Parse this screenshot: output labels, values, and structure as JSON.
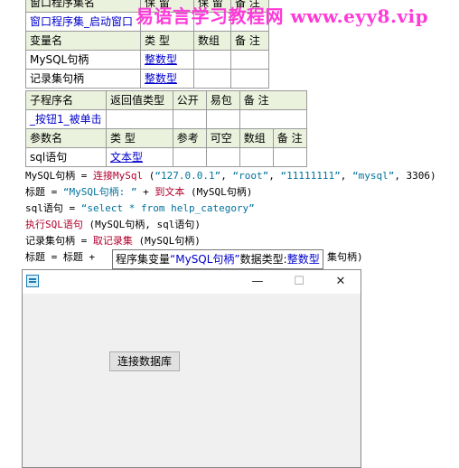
{
  "watermark": "易语言学习教程网 www.eyy8.vip",
  "table1": {
    "row0": [
      "窗口程序集名",
      "保 留",
      "保 留",
      "备 注"
    ],
    "row1": "窗口程序集_启动窗口",
    "header": [
      "变量名",
      "类 型",
      "数组",
      "备 注"
    ],
    "vars": [
      {
        "name": "MySQL句柄",
        "type": "整数型"
      },
      {
        "name": "记录集句柄",
        "type": "整数型"
      }
    ]
  },
  "table2": {
    "header": [
      "子程序名",
      "返回值类型",
      "公开",
      "易包",
      "备 注"
    ],
    "sub_name": "_按钮1_被单击",
    "param_header": [
      "参数名",
      "类 型",
      "参考",
      "可空",
      "数组",
      "备 注"
    ],
    "param": {
      "name": "sql语句",
      "type": "文本型"
    }
  },
  "code": {
    "line1": {
      "a": "MySQL句柄 = ",
      "b": "连接MySql",
      "c": " (",
      "d": "“127.0.0.1”",
      "e": ", ",
      "f": "“root”",
      "g": ", ",
      "h": "“11111111”",
      "i": ", ",
      "j": "“mysql”",
      "k": ", 3306)"
    },
    "line2": {
      "a": "标题 = ",
      "b": "“MySQL句柄: ”",
      "c": " + ",
      "d": "到文本",
      "e": " (MySQL句柄)"
    },
    "line3": {
      "a": "sql语句 = ",
      "b": "“select * from help_category”"
    },
    "line4": {
      "a": "执行SQL语句",
      "b": " (MySQL句柄, sql语句)"
    },
    "line5": {
      "a": "记录集句柄 = ",
      "b": "取记录集",
      "c": " (MySQL句柄)"
    },
    "line6": {
      "a": "标题 = 标题 + ",
      "b": "集句柄)"
    }
  },
  "tooltip": {
    "a": "程序集变量",
    "b": "“MySQL句柄”",
    "c": "数据类型:",
    "d": "整数型"
  },
  "window": {
    "minimize": "—",
    "maximize": "☐",
    "close": "✕",
    "button_label": "连接数据库"
  }
}
